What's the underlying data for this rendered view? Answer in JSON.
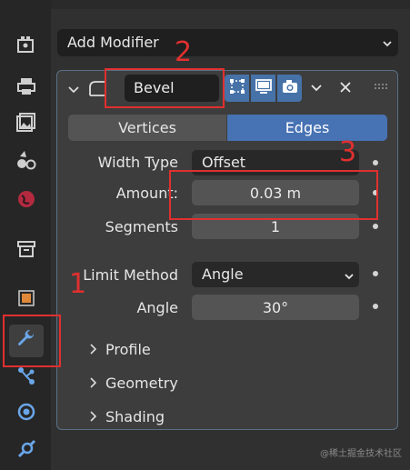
{
  "add_modifier": {
    "label": "Add Modifier"
  },
  "modifier": {
    "name": "Bevel",
    "tabs": [
      {
        "label": "Vertices"
      },
      {
        "label": "Edges"
      }
    ],
    "width_type": {
      "label": "Width Type",
      "value": "Offset"
    },
    "amount": {
      "label": "Amount:",
      "value": "0.03 m"
    },
    "segments": {
      "label": "Segments",
      "value": "1"
    },
    "limit_method": {
      "label": "Limit Method",
      "value": "Angle"
    },
    "angle": {
      "label": "Angle",
      "value": "30°"
    },
    "sections": [
      {
        "label": "Profile"
      },
      {
        "label": "Geometry"
      },
      {
        "label": "Shading"
      }
    ]
  },
  "annotations": [
    {
      "number": "1"
    },
    {
      "number": "2"
    },
    {
      "number": "3"
    }
  ],
  "watermark": "@稀土掘金技术社区",
  "colors": {
    "accent": "#4772b3",
    "annotation": "#e0302f"
  }
}
